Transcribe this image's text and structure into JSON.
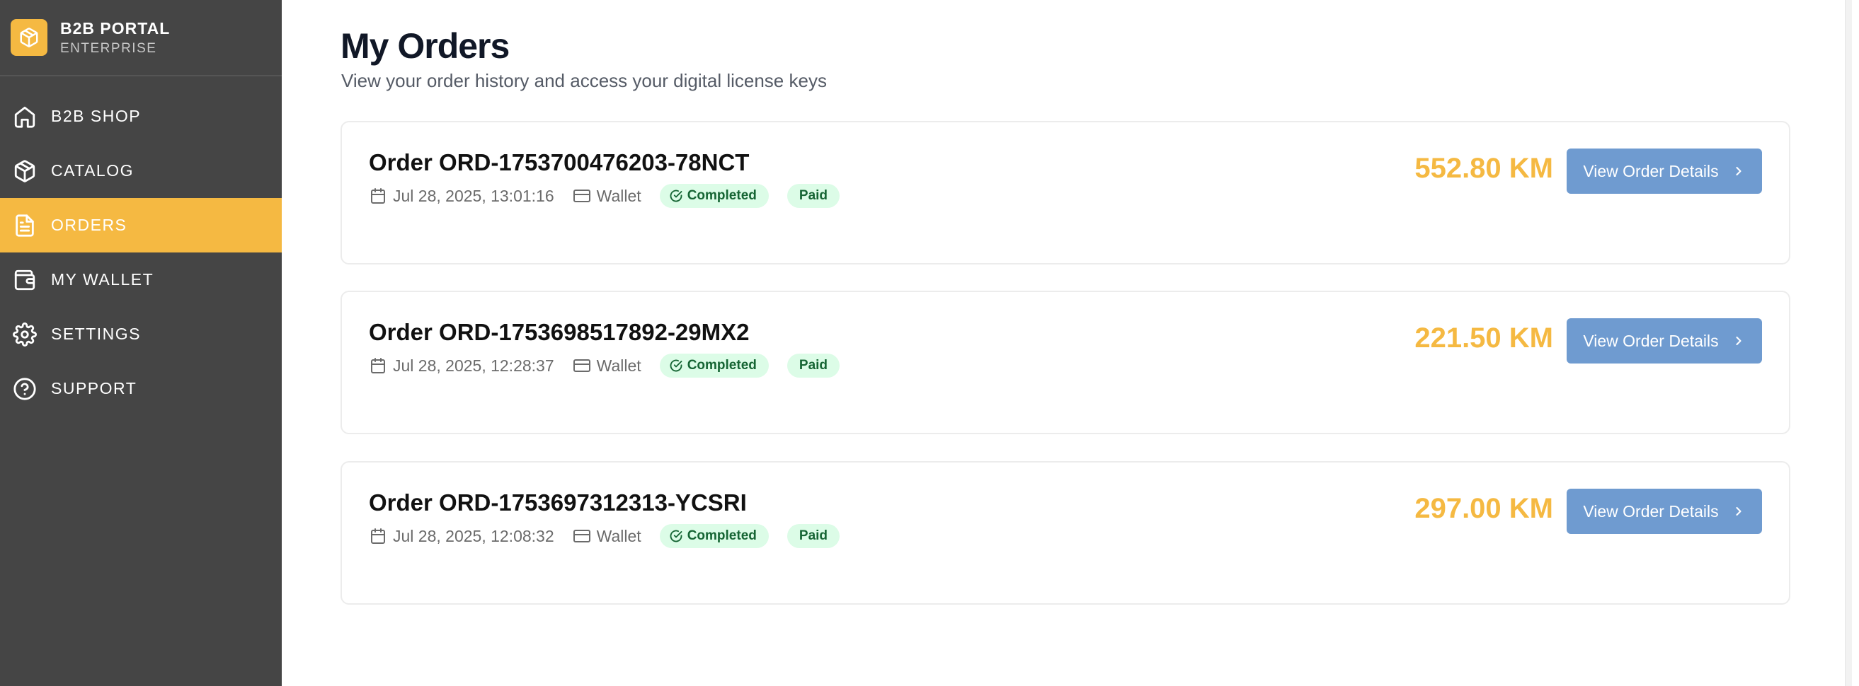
{
  "brand": {
    "title": "B2B PORTAL",
    "subtitle": "ENTERPRISE",
    "icon": "package-icon",
    "accent_color": "#f5b942"
  },
  "sidebar": {
    "background": "#454545",
    "items": [
      {
        "label": "B2B SHOP",
        "icon": "home-icon",
        "active": false
      },
      {
        "label": "CATALOG",
        "icon": "package-icon",
        "active": false
      },
      {
        "label": "ORDERS",
        "icon": "document-icon",
        "active": true
      },
      {
        "label": "MY WALLET",
        "icon": "wallet-icon",
        "active": false
      },
      {
        "label": "SETTINGS",
        "icon": "gear-icon",
        "active": false
      },
      {
        "label": "SUPPORT",
        "icon": "help-circle-icon",
        "active": false
      }
    ]
  },
  "page": {
    "title": "My Orders",
    "subtitle": "View your order history and access your digital license keys"
  },
  "orders": [
    {
      "title": "Order ORD-1753700476203-78NCT",
      "date": "Jul 28, 2025, 13:01:16",
      "payment_method": "Wallet",
      "status": "Completed",
      "payment_status": "Paid",
      "amount": "552.80 KM",
      "button_label": "View Order Details"
    },
    {
      "title": "Order ORD-1753698517892-29MX2",
      "date": "Jul 28, 2025, 12:28:37",
      "payment_method": "Wallet",
      "status": "Completed",
      "payment_status": "Paid",
      "amount": "221.50 KM",
      "button_label": "View Order Details"
    },
    {
      "title": "Order ORD-1753697312313-YCSRI",
      "date": "Jul 28, 2025, 12:08:32",
      "payment_method": "Wallet",
      "status": "Completed",
      "payment_status": "Paid",
      "amount": "297.00 KM",
      "button_label": "View Order Details"
    }
  ],
  "colors": {
    "amount": "#f5b942",
    "button": "#6f9bd0",
    "badge_bg": "#dcfce7",
    "badge_text": "#166534"
  }
}
